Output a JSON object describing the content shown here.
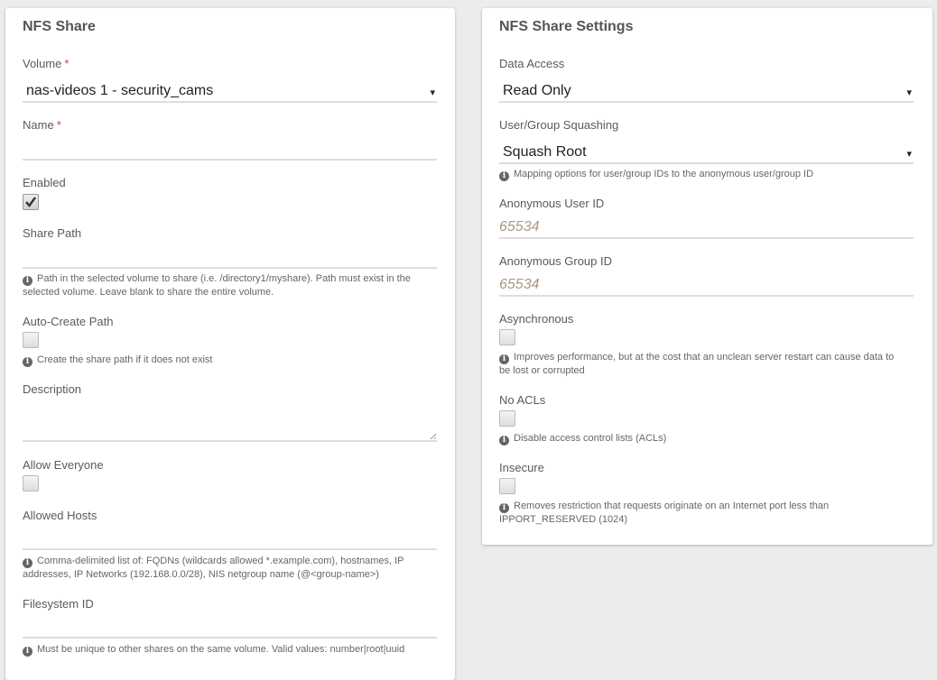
{
  "left": {
    "title": "NFS Share",
    "volume": {
      "label": "Volume",
      "value": "nas-videos 1 - security_cams",
      "required_mark": "*"
    },
    "name": {
      "label": "Name",
      "value": "",
      "required_mark": "*"
    },
    "enabled": {
      "label": "Enabled",
      "checked": true
    },
    "share_path": {
      "label": "Share Path",
      "value": "",
      "help": "Path in the selected volume to share (i.e. /directory1/myshare). Path must exist in the selected volume. Leave blank to share the entire volume."
    },
    "auto_create": {
      "label": "Auto-Create Path",
      "checked": false,
      "help": "Create the share path if it does not exist"
    },
    "description": {
      "label": "Description",
      "value": ""
    },
    "allow_everyone": {
      "label": "Allow Everyone",
      "checked": false
    },
    "allowed_hosts": {
      "label": "Allowed Hosts",
      "value": "",
      "help": "Comma-delimited list of: FQDNs (wildcards allowed *.example.com), hostnames, IP addresses, IP Networks (192.168.0.0/28), NIS netgroup name (@<group-name>)"
    },
    "filesystem_id": {
      "label": "Filesystem ID",
      "value": "",
      "help": "Must be unique to other shares on the same volume. Valid values: number|root|uuid"
    }
  },
  "right": {
    "title": "NFS Share Settings",
    "data_access": {
      "label": "Data Access",
      "value": "Read Only"
    },
    "squashing": {
      "label": "User/Group Squashing",
      "value": "Squash Root",
      "help": "Mapping options for user/group IDs to the anonymous user/group ID"
    },
    "anon_user": {
      "label": "Anonymous User ID",
      "placeholder": "65534"
    },
    "anon_group": {
      "label": "Anonymous Group ID",
      "placeholder": "65534"
    },
    "asynchronous": {
      "label": "Asynchronous",
      "checked": false,
      "help": "Improves performance, but at the cost that an unclean server restart can cause data to be lost or corrupted"
    },
    "no_acls": {
      "label": "No ACLs",
      "checked": false,
      "help": "Disable access control lists (ACLs)"
    },
    "insecure": {
      "label": "Insecure",
      "checked": false,
      "help": "Removes restriction that requests originate on an Internet port less than IPPORT_RESERVED (1024)"
    }
  },
  "icons": {
    "info": "i",
    "caret": "▾"
  }
}
